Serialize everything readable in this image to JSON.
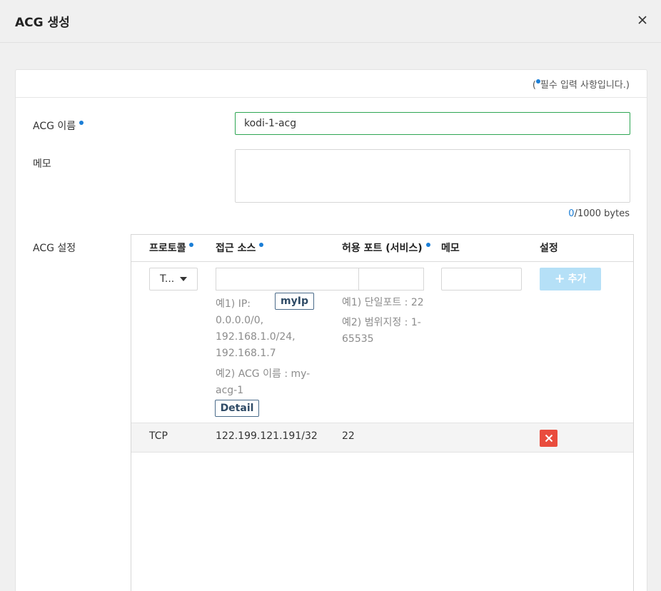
{
  "header": {
    "title": "ACG 생성"
  },
  "form": {
    "required_note_open": "(",
    "required_note": "필수 입력 사항입니다.)",
    "acg_name_label": "ACG 이름",
    "acg_name_value": "kodi-1-acg",
    "memo_label": "메모",
    "bytes_count": "0",
    "bytes_total": "/1000 bytes",
    "acg_settings_label": "ACG 설정"
  },
  "acg_table": {
    "columns": {
      "protocol": "프로토콜",
      "source": "접근 소스",
      "port": "허용 포트 (서비스)",
      "memo": "메모",
      "settings": "설정"
    },
    "protocol_select": "T...",
    "add_button": "추가",
    "myip_button": "myIp",
    "detail_button": "Detail",
    "source_hints": [
      "예1) IP:",
      "0.0.0.0/0,",
      "192.168.1.0/24,",
      "192.168.1.7",
      "예2) ACG 이름 : my-",
      "acg-1"
    ],
    "port_hints": [
      "예1) 단일포트 : 22",
      "예2) 범위지정 : 1-",
      "65535"
    ],
    "rules": [
      {
        "protocol": "TCP",
        "source": "122.199.121.191/32",
        "port": "22"
      }
    ]
  },
  "colors": {
    "accent": "#1b7ed6",
    "valid_border": "#2ea653",
    "add_button": "#b5e0f7",
    "delete_button": "#e94c3d"
  }
}
